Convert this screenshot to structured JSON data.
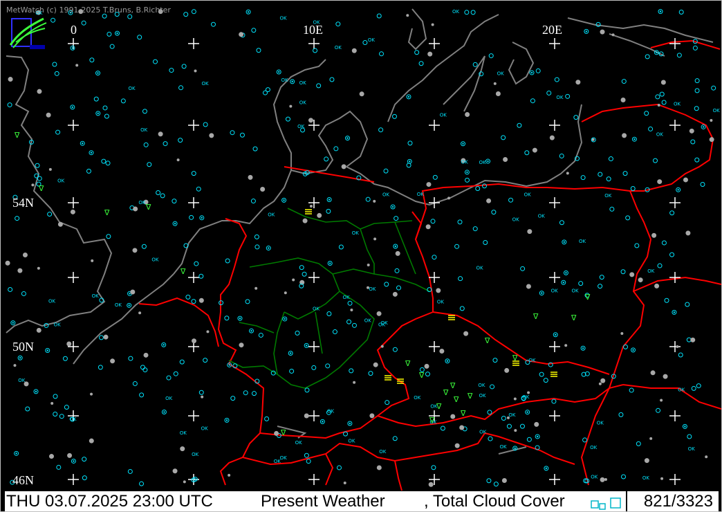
{
  "app": {
    "copyright": "MetWatch  (c) 1991-2025 T.Bruns, B.Richter"
  },
  "map": {
    "longitude_labels": [
      "0",
      "10E",
      "20E"
    ],
    "latitude_labels": [
      "54N",
      "50N",
      "46N"
    ],
    "colors": {
      "background": "#000000",
      "coastline": "#808080",
      "country_border": "#ff0000",
      "state_border": "#007a00",
      "grid_cross": "#ffffff",
      "station_clear": "#00e5ff",
      "station_cloudy": "#a8a8a8",
      "precipitation": "#3cff3c",
      "fog_haze": "#ffff00"
    }
  },
  "status": {
    "time": "THU 03.07.2025 23:00 UTC",
    "parameter_1": "Present Weather",
    "parameter_2": ", Total Cloud Cover",
    "station_count": "821/3323"
  }
}
